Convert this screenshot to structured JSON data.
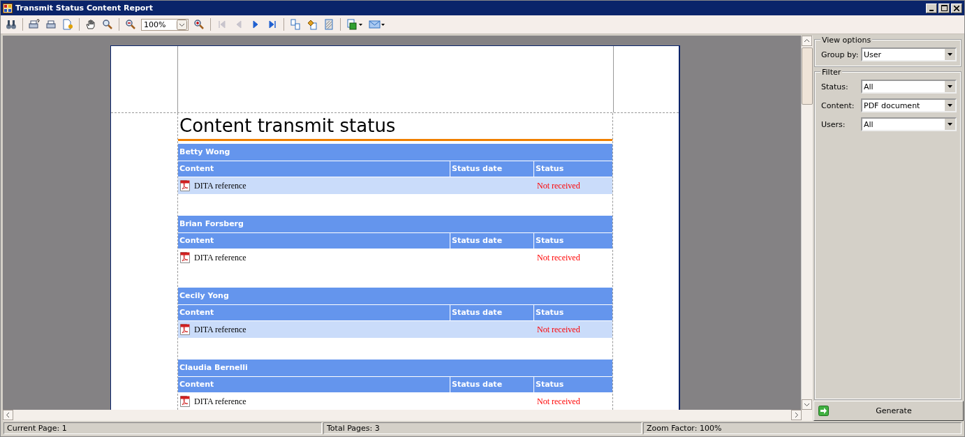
{
  "window": {
    "title": "Transmit Status Content Report"
  },
  "toolbar": {
    "zoom": {
      "value": "100%"
    },
    "navigation": [
      {
        "disabled": true
      },
      {
        "disabled": true
      },
      {
        "disabled": false
      },
      {
        "disabled": false
      }
    ]
  },
  "report": {
    "title": "Content transmit status",
    "groups": [
      {
        "user": "Betty Wong",
        "columns": [
          "Content",
          "Status date",
          "Status"
        ],
        "rows": [
          {
            "content": "DITA reference",
            "status": "Not received",
            "shaded": true
          }
        ]
      },
      {
        "user": "Brian Forsberg",
        "columns": [
          "Content",
          "Status date",
          "Status"
        ],
        "rows": [
          {
            "content": "DITA reference",
            "status": "Not received",
            "shaded": false
          }
        ]
      },
      {
        "user": "Cecily Yong",
        "columns": [
          "Content",
          "Status date",
          "Status"
        ],
        "rows": [
          {
            "content": "DITA reference",
            "status": "Not received",
            "shaded": true
          }
        ]
      },
      {
        "user": "Claudia Bernelli",
        "columns": [
          "Content",
          "Status date",
          "Status"
        ],
        "rows": [
          {
            "content": "DITA reference",
            "status": "Not received",
            "shaded": false
          }
        ]
      }
    ]
  },
  "view_options": {
    "title": "View options",
    "fields": [
      {
        "label": "Group by:",
        "value": "User"
      }
    ]
  },
  "filter": {
    "title": "Filter",
    "fields": [
      {
        "label": "Status:",
        "value": "All"
      },
      {
        "label": "Content:",
        "value": "PDF document"
      },
      {
        "label": "Users:",
        "value": "All"
      }
    ]
  },
  "generate_button": {
    "label": "Generate"
  },
  "status_bar": [
    "Current Page: 1",
    "Total Pages: 3",
    "Zoom Factor: 100%"
  ]
}
